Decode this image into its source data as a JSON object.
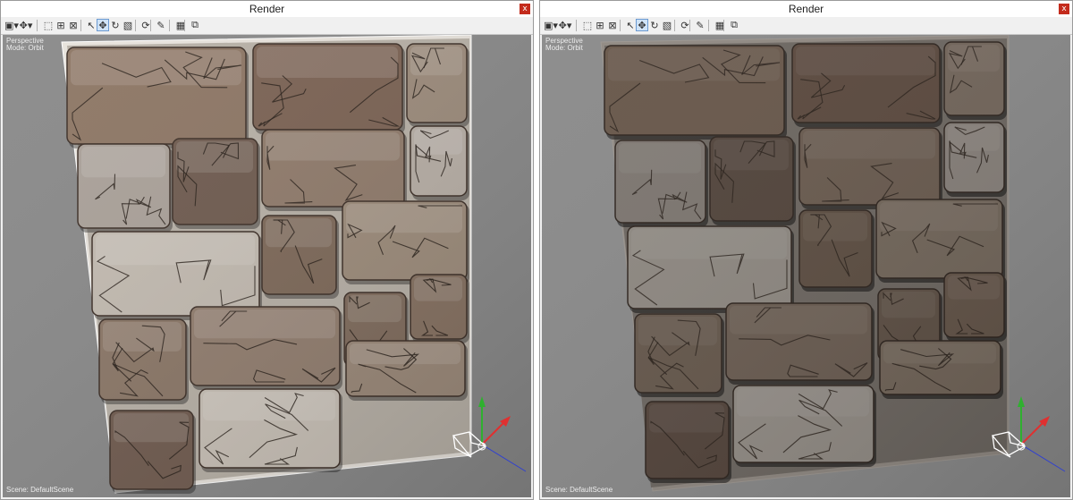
{
  "windows": [
    {
      "title": "Render",
      "close_label": "x",
      "viewport": {
        "camera_label": "Perspective",
        "mode_label": "Mode: Orbit",
        "scene_label": "Scene: DefaultScene"
      },
      "render_style": "bright"
    },
    {
      "title": "Render",
      "close_label": "x",
      "viewport": {
        "camera_label": "Perspective",
        "mode_label": "Mode: Orbit",
        "scene_label": "Scene: DefaultScene"
      },
      "render_style": "dark"
    }
  ],
  "toolbar_icons": [
    "camera-dropdown-icon",
    "light-dropdown-icon",
    "zoom-extents-icon",
    "zoom-region-icon",
    "zoom-selected-icon",
    "select-icon",
    "pan-icon",
    "orbit-icon",
    "frame-icon",
    "rotate-icon",
    "paint-icon",
    "snapshot-icon",
    "export-icon"
  ],
  "colors": {
    "viewport_bg": "#888888",
    "close_button": "#c42b1c",
    "axis_x": "#e03030",
    "axis_y": "#2fb02f",
    "axis_z": "#3040d0"
  }
}
